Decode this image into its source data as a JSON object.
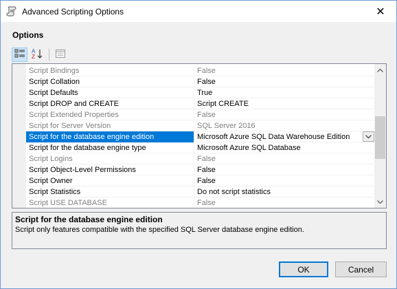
{
  "window": {
    "title": "Advanced Scripting Options",
    "close_glyph": "✕"
  },
  "section_label": "Options",
  "toolbar": {
    "items": [
      {
        "icon": "categorized-icon",
        "active": true
      },
      {
        "icon": "alphabetical-sort-icon",
        "active": false
      },
      {
        "icon": "property-pages-icon",
        "active": false
      }
    ]
  },
  "properties": [
    {
      "name": "Script Bindings",
      "value": "False",
      "disabled": true
    },
    {
      "name": "Script Collation",
      "value": "False",
      "disabled": false
    },
    {
      "name": "Script Defaults",
      "value": "True",
      "disabled": false
    },
    {
      "name": "Script DROP and CREATE",
      "value": "Script CREATE",
      "disabled": false
    },
    {
      "name": "Script Extended Properties",
      "value": "False",
      "disabled": true
    },
    {
      "name": "Script for Server Version",
      "value": "SQL Server 2016",
      "disabled": true
    },
    {
      "name": "Script for the database engine edition",
      "value": "Microsoft Azure SQL Data Warehouse Edition",
      "disabled": false,
      "selected": true
    },
    {
      "name": "Script for the database engine type",
      "value": "Microsoft Azure SQL Database",
      "disabled": false
    },
    {
      "name": "Script Logins",
      "value": "False",
      "disabled": true
    },
    {
      "name": "Script Object-Level Permissions",
      "value": "False",
      "disabled": false
    },
    {
      "name": "Script Owner",
      "value": "False",
      "disabled": false
    },
    {
      "name": "Script Statistics",
      "value": "Do not script statistics",
      "disabled": false
    },
    {
      "name": "Script USE DATABASE",
      "value": "False",
      "disabled": true
    }
  ],
  "description": {
    "title": "Script for the database engine edition",
    "text": "Script only features compatible with the specified SQL Server database engine edition."
  },
  "buttons": {
    "ok": "OK",
    "cancel": "Cancel"
  },
  "colors": {
    "selection": "#0078d7",
    "disabled_text": "#808080"
  }
}
